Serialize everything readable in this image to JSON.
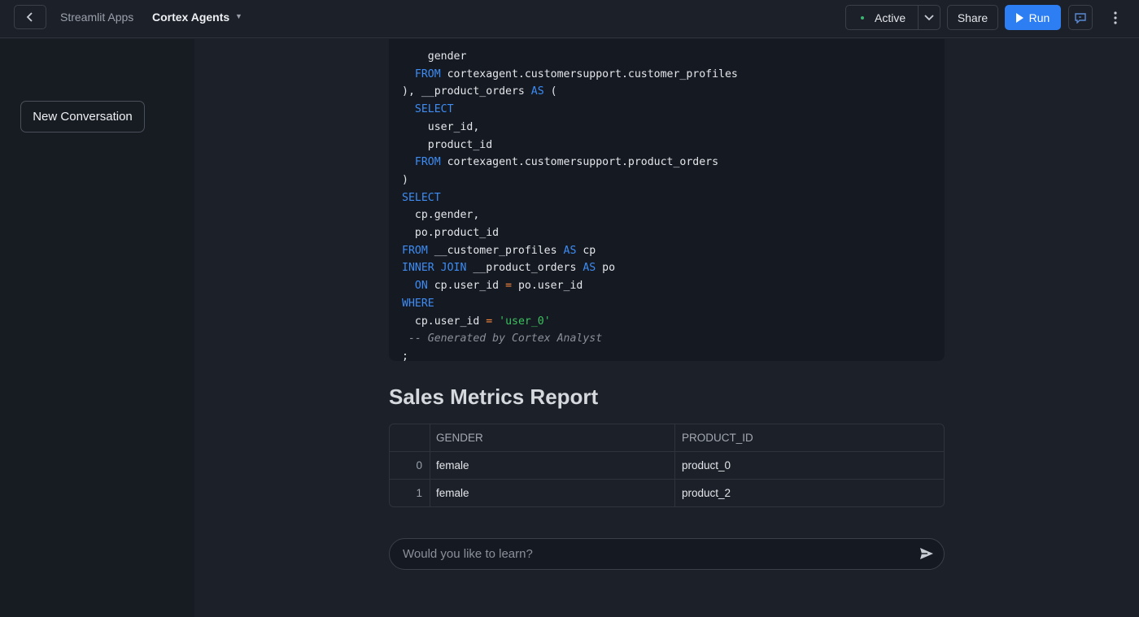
{
  "header": {
    "breadcrumb_parent": "Streamlit Apps",
    "app_name": "Cortex Agents",
    "status": "Active",
    "share_label": "Share",
    "run_label": "Run"
  },
  "sidebar": {
    "new_conversation_label": "New Conversation"
  },
  "code": {
    "language": "sql",
    "lines": [
      "    gender",
      "  FROM cortexagent.customersupport.customer_profiles",
      "), __product_orders AS (",
      "  SELECT",
      "    user_id,",
      "    product_id",
      "  FROM cortexagent.customersupport.product_orders",
      ")",
      "SELECT",
      "  cp.gender,",
      "  po.product_id",
      "FROM __customer_profiles AS cp",
      "INNER JOIN __product_orders AS po",
      "  ON cp.user_id = po.user_id",
      "WHERE",
      "  cp.user_id = 'user_0'",
      " -- Generated by Cortex Analyst",
      ";"
    ]
  },
  "report": {
    "title": "Sales Metrics Report",
    "columns": [
      "",
      "GENDER",
      "PRODUCT_ID"
    ],
    "rows": [
      [
        "0",
        "female",
        "product_0"
      ],
      [
        "1",
        "female",
        "product_2"
      ]
    ]
  },
  "chat": {
    "placeholder": "Would you like to learn?"
  },
  "colors": {
    "accent": "#2c7ef2",
    "keyword": "#3d8df5",
    "string": "#3cc15e",
    "operator": "#ff8a3d",
    "status_dot": "#3cb371"
  }
}
